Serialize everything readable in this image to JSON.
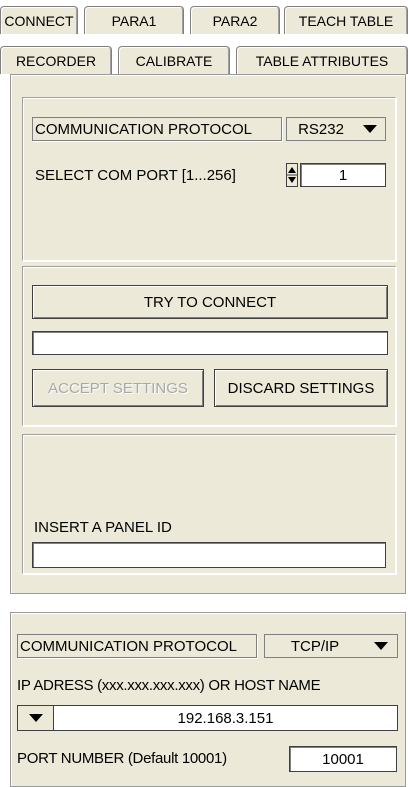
{
  "tabs": {
    "row1": [
      "CONNECT",
      "PARA1",
      "PARA2",
      "TEACH TABLE"
    ],
    "row2": [
      "RECORDER",
      "CALIBRATE",
      "TABLE ATTRIBUTES"
    ]
  },
  "serial": {
    "protocol_label": "COMMUNICATION PROTOCOL",
    "protocol_value": "RS232",
    "com_port_label": "SELECT COM PORT [1...256]",
    "com_port_value": "1"
  },
  "connect": {
    "try_button": "TRY TO CONNECT",
    "status_value": "",
    "accept_button": "ACCEPT SETTINGS",
    "discard_button": "DISCARD SETTINGS"
  },
  "panel_id": {
    "label": "INSERT A PANEL ID",
    "value": ""
  },
  "tcp": {
    "protocol_label": "COMMUNICATION PROTOCOL",
    "protocol_value": "TCP/IP",
    "ip_label": "IP ADRESS (xxx.xxx.xxx.xxx) OR HOST NAME",
    "ip_value": "192.168.3.151",
    "port_label": "PORT NUMBER (Default 10001)",
    "port_value": "10001"
  }
}
